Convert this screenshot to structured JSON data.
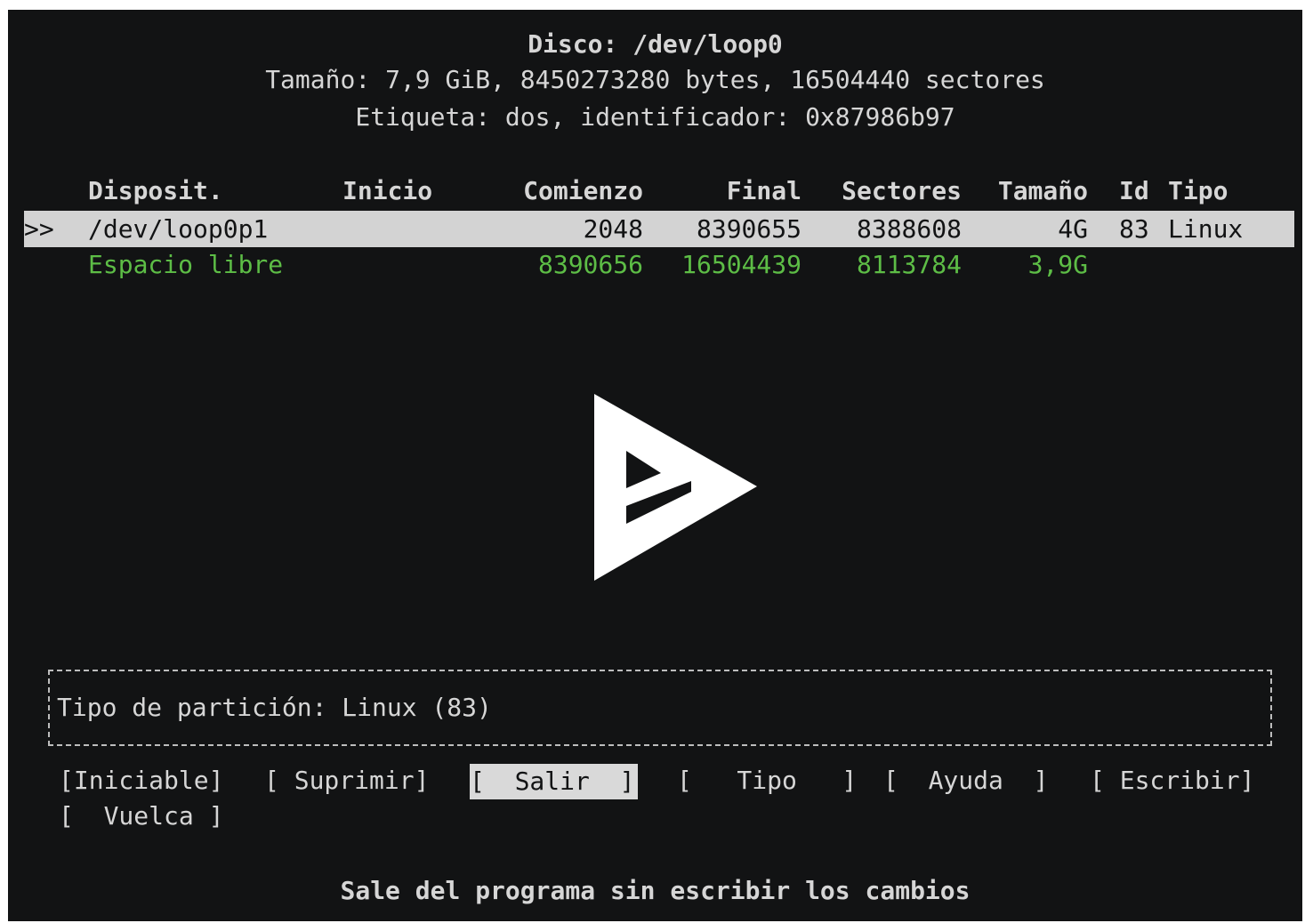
{
  "header": {
    "disk": "Disco: /dev/loop0",
    "size": "Tamaño: 7,9 GiB, 8450273280 bytes, 16504440 sectores",
    "label": "Etiqueta: dos, identificador: 0x87986b97"
  },
  "table": {
    "columns": [
      "Disposit.",
      "Inicio",
      "Comienzo",
      "Final",
      "Sectores",
      "Tamaño",
      "Id",
      "Tipo"
    ],
    "rows": [
      {
        "marker": ">>",
        "device": "/dev/loop0p1",
        "boot": "",
        "start": "2048",
        "end": "8390655",
        "sectors": "8388608",
        "size": "4G",
        "id": "83",
        "type": "Linux"
      },
      {
        "marker": "",
        "device": "Espacio libre",
        "boot": "",
        "start": "8390656",
        "end": "16504439",
        "sectors": "8113784",
        "size": "3,9G",
        "id": "",
        "type": ""
      }
    ]
  },
  "info_box": {
    "text": "Tipo de partición: Linux (83)"
  },
  "menu": {
    "buttons": [
      "[Iniciable]",
      "[ Suprimir]",
      "[  Salir  ]",
      "[   Tipo   ]",
      "[  Ayuda  ]",
      "[ Escribir]",
      "[  Vuelca ]"
    ],
    "selected": "[  Salir  ]"
  },
  "status": "Sale del programa sin escribir los cambios",
  "overlay": {
    "icon": "play-logo-icon"
  },
  "colors": {
    "background": "#121314",
    "text": "#d6d6d6",
    "free_space": "#5dbd46",
    "selection": "#d3d3d3"
  }
}
